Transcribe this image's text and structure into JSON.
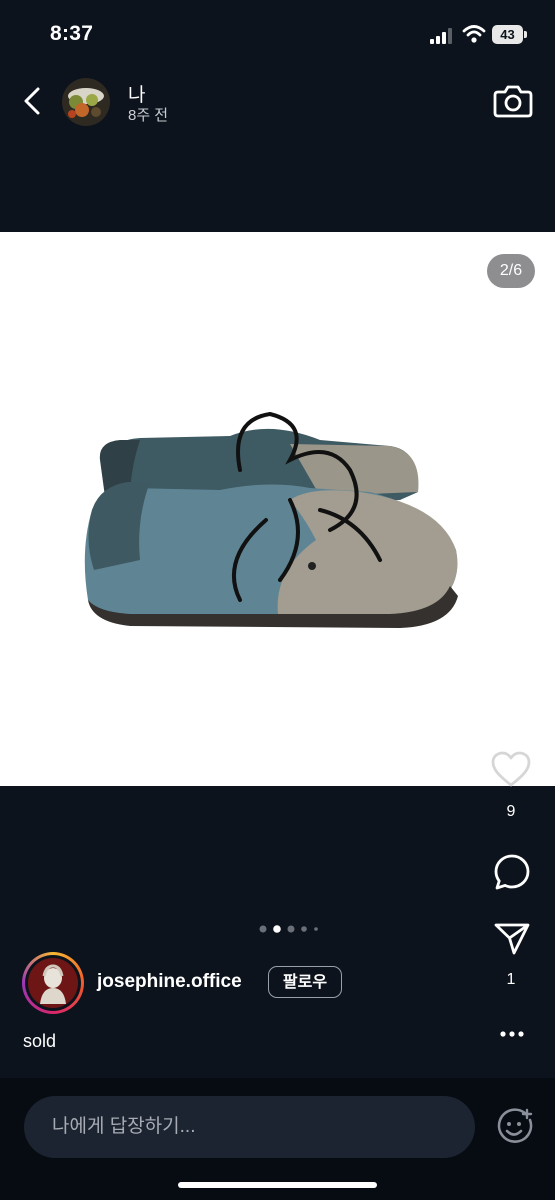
{
  "status": {
    "time": "8:37",
    "battery": "43"
  },
  "story": {
    "name": "나",
    "time_ago": "8주 전"
  },
  "post": {
    "page_counter": "2/6",
    "likes": "9",
    "shares": "1",
    "carousel": {
      "total_dots": 5,
      "active_index": 1
    }
  },
  "author": {
    "username": "josephine.office",
    "follow_label": "팔로우"
  },
  "caption": "sold",
  "reply": {
    "placeholder": "나에게 답장하기..."
  },
  "colors": {
    "background": "#0d131c",
    "input": "#1c2431",
    "image_bg": "#ffffff"
  },
  "icons": [
    "back-icon",
    "camera-icon",
    "heart-icon",
    "comment-icon",
    "send-icon",
    "more-icon",
    "emoji-icon"
  ]
}
